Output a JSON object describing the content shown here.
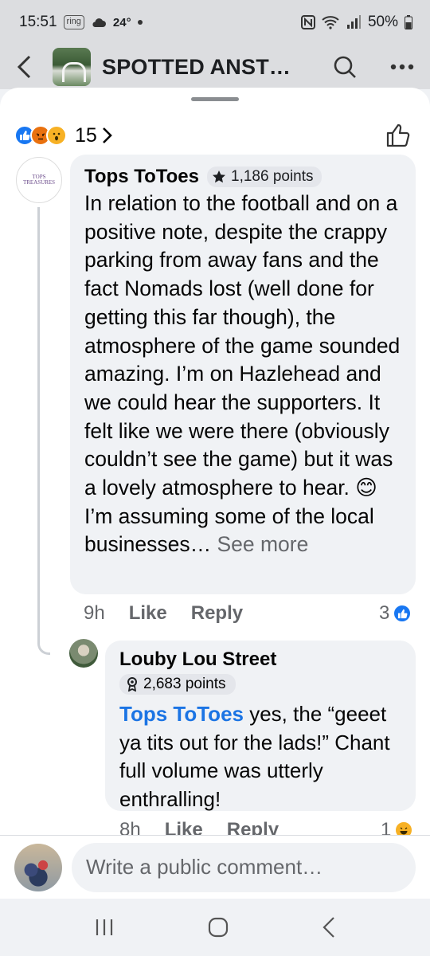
{
  "status_bar": {
    "time": "15:51",
    "ring_badge": "ring",
    "temperature": "24°",
    "battery": "50%"
  },
  "app_bar": {
    "title": "SPOTTED ANST…"
  },
  "reactions": {
    "count": "15"
  },
  "comments": [
    {
      "author": "Tops ToToes",
      "avatar_text": "TOPS TREASURES",
      "points": "1,186 points",
      "body": "In relation to the football and on a positive note, despite the crappy parking from away fans and the fact Nomads lost (well done for getting this far though), the atmosphere of the game sounded amazing. I’m on Hazlehead and we could hear the supporters. It felt like we were there (obviously couldn’t see the game) but it was a lovely atmosphere to hear. 😊 I’m assuming some of the local businesses…",
      "see_more": "See more",
      "time": "9h",
      "like_label": "Like",
      "reply_label": "Reply",
      "like_count": "3"
    },
    {
      "author": "Louby Lou Street",
      "points": "2,683 points",
      "mention": "Tops ToToes",
      "body": " yes, the “geeet ya tits out for the lads!” Chant full volume was utterly enthralling!",
      "time": "8h",
      "like_label": "Like",
      "reply_label": "Reply",
      "reaction_count": "1"
    }
  ],
  "composer": {
    "placeholder": "Write a public comment…"
  },
  "colors": {
    "accent": "#1877f2",
    "mention": "#1b74e4",
    "bubble": "#f0f2f5"
  }
}
